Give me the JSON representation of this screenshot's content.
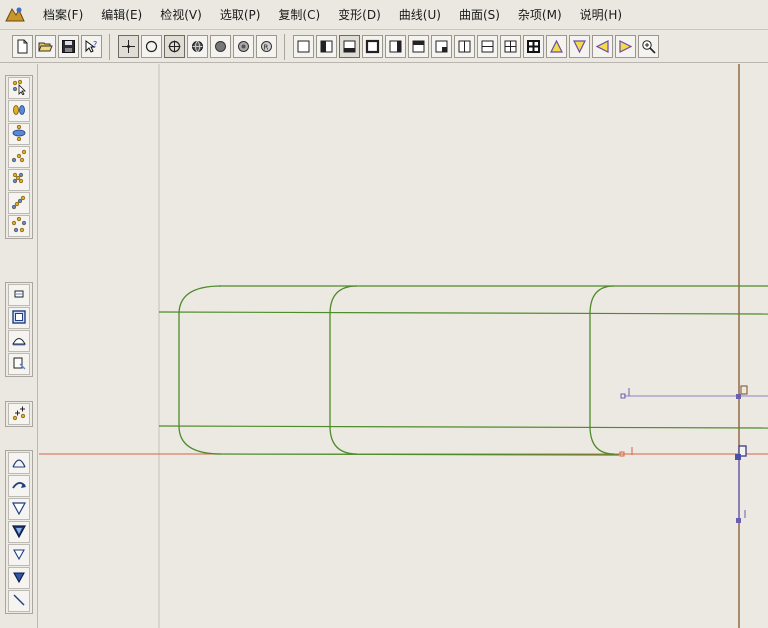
{
  "menu": {
    "items": [
      {
        "label": "档案(F)",
        "name": "menu-file"
      },
      {
        "label": "编辑(E)",
        "name": "menu-edit"
      },
      {
        "label": "检视(V)",
        "name": "menu-view"
      },
      {
        "label": "选取(P)",
        "name": "menu-select"
      },
      {
        "label": "复制(C)",
        "name": "menu-copy"
      },
      {
        "label": "变形(D)",
        "name": "menu-transform"
      },
      {
        "label": "曲线(U)",
        "name": "menu-curve"
      },
      {
        "label": "曲面(S)",
        "name": "menu-surface"
      },
      {
        "label": "杂项(M)",
        "name": "menu-misc"
      },
      {
        "label": "说明(H)",
        "name": "menu-help"
      }
    ]
  },
  "toolbar": {
    "buttons": [
      {
        "name": "new-file-button",
        "icon": "new-file-icon"
      },
      {
        "name": "open-file-button",
        "icon": "open-folder-icon"
      },
      {
        "name": "save-button",
        "icon": "save-icon"
      },
      {
        "name": "help-pointer-button",
        "icon": "help-pointer-icon"
      },
      {
        "name": "point-snap-button",
        "icon": "crosshair-point-icon",
        "pressed": true
      },
      {
        "name": "circle-snap-button",
        "icon": "circle-icon"
      },
      {
        "name": "center-snap-button",
        "icon": "circle-cross-icon",
        "pressed": true
      },
      {
        "name": "sphere-view-button",
        "icon": "sphere-grid-icon"
      },
      {
        "name": "shaded-view-button",
        "icon": "filled-circle-icon"
      },
      {
        "name": "render-view-button",
        "icon": "render-sphere-icon"
      },
      {
        "name": "rotate-view-button",
        "icon": "rotate-sphere-icon"
      },
      {
        "name": "view-single-button",
        "icon": "window-icon"
      },
      {
        "name": "view-left-button",
        "icon": "window-left-icon"
      },
      {
        "name": "view-bottom-button",
        "icon": "window-bottom-icon",
        "pressed": true
      },
      {
        "name": "view-full-button",
        "icon": "window-full-icon"
      },
      {
        "name": "view-right-button",
        "icon": "window-right-icon"
      },
      {
        "name": "view-top-button",
        "icon": "window-top-icon"
      },
      {
        "name": "view-corner-button",
        "icon": "window-corner-icon"
      },
      {
        "name": "split-vertical-button",
        "icon": "split-vertical-icon"
      },
      {
        "name": "split-horizontal-button",
        "icon": "split-horizontal-icon"
      },
      {
        "name": "split-four-button",
        "icon": "split-four-icon"
      },
      {
        "name": "split-four-bold-button",
        "icon": "split-four-bold-icon"
      },
      {
        "name": "view-up-button",
        "icon": "triangle-up-icon"
      },
      {
        "name": "view-down-button",
        "icon": "triangle-down-icon"
      },
      {
        "name": "view-left-arrow-button",
        "icon": "triangle-left-icon"
      },
      {
        "name": "view-right-arrow-button",
        "icon": "triangle-right-icon"
      },
      {
        "name": "zoom-in-button",
        "icon": "zoom-in-icon"
      }
    ]
  },
  "toolbox": {
    "groups": [
      [
        "select-pointer-icon",
        "select-pair-icon",
        "ellipse-points-icon",
        "scatter-points-icon",
        "grid-points-icon",
        "diagonal-points-icon",
        "ring-points-icon"
      ],
      [
        "rectangle-small-icon",
        "rectangle-frame-icon",
        "arc-base-icon",
        "rect-edit-icon"
      ],
      [
        "plus-points-icon"
      ],
      [
        "arch-icon",
        "rotate-arrow-icon",
        "triangle-down-outline-icon",
        "triangle-down-bold-icon",
        "triangle-down-small-icon",
        "triangle-down-bold-small-icon",
        "line-tool-icon"
      ]
    ]
  },
  "colors": {
    "canvas": "#ece9e2",
    "curve": "#4e8b2a",
    "axis_red": "#d8644c",
    "axis_brown": "#7a4a24",
    "selection_blue": "#6b5fb0",
    "guide_gray": "#c8c3b8"
  }
}
